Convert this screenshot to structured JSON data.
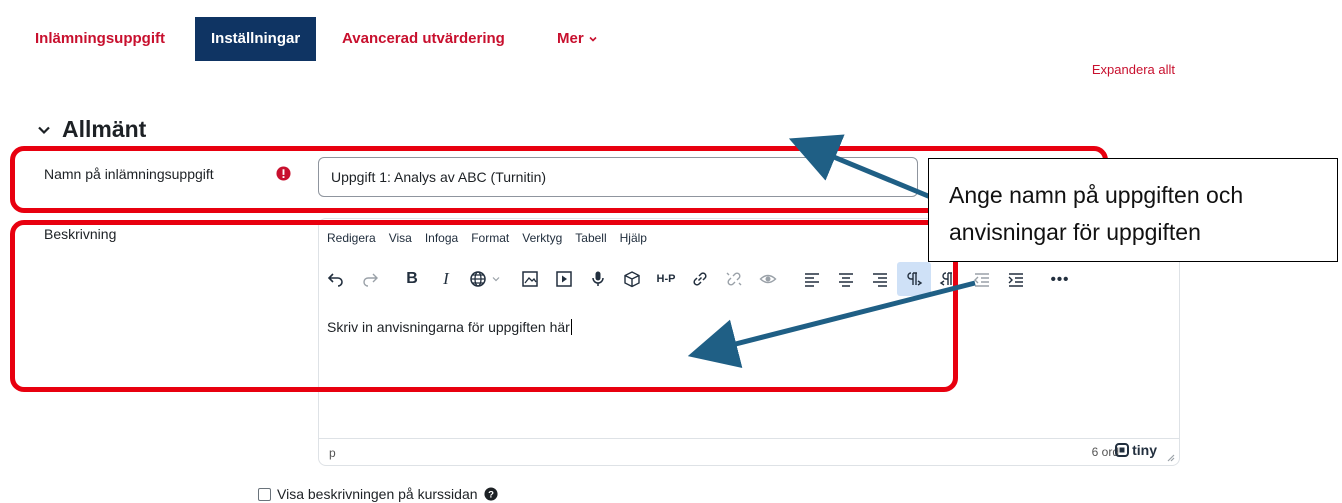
{
  "tabs": [
    {
      "label": "Inlämningsuppgift",
      "active": false
    },
    {
      "label": "Inställningar",
      "active": true
    },
    {
      "label": "Avancerad utvärdering",
      "active": false
    },
    {
      "label": "Mer",
      "active": false
    }
  ],
  "expand_all": "Expandera allt",
  "section": {
    "title": "Allmänt"
  },
  "form": {
    "name_label": "Namn på inlämningsuppgift",
    "name_value": "Uppgift 1: Analys av ABC (Turnitin)",
    "description_label": "Beskrivning"
  },
  "editor": {
    "menu": [
      "Redigera",
      "Visa",
      "Infoga",
      "Format",
      "Verktyg",
      "Tabell",
      "Hjälp"
    ],
    "toolbar_icons": [
      "undo-icon",
      "redo-icon",
      "bold-icon",
      "italic-icon",
      "language-icon",
      "image-icon",
      "media-icon",
      "record-audio-icon",
      "package-icon",
      "h5p-icon",
      "link-icon",
      "unlink-icon",
      "preview-icon",
      "align-left-icon",
      "align-center-icon",
      "align-right-icon",
      "ltr-icon",
      "rtl-icon",
      "outdent-icon",
      "indent-icon",
      "more-icon"
    ],
    "content": "Skriv in anvisningarna för uppgiften här",
    "path": "p",
    "word_count": "6 ord",
    "brand": "tiny"
  },
  "checkbox": {
    "label": "Visa beskrivningen på kurssidan",
    "checked": false
  },
  "annotation": {
    "line1": "Ange namn på uppgiften och",
    "line2": "anvisningar för uppgiften"
  },
  "colors": {
    "accent_red": "#c8102e",
    "active_tab": "#0f3463",
    "annotation_red": "#e8000f",
    "arrow": "#1f5f85"
  }
}
